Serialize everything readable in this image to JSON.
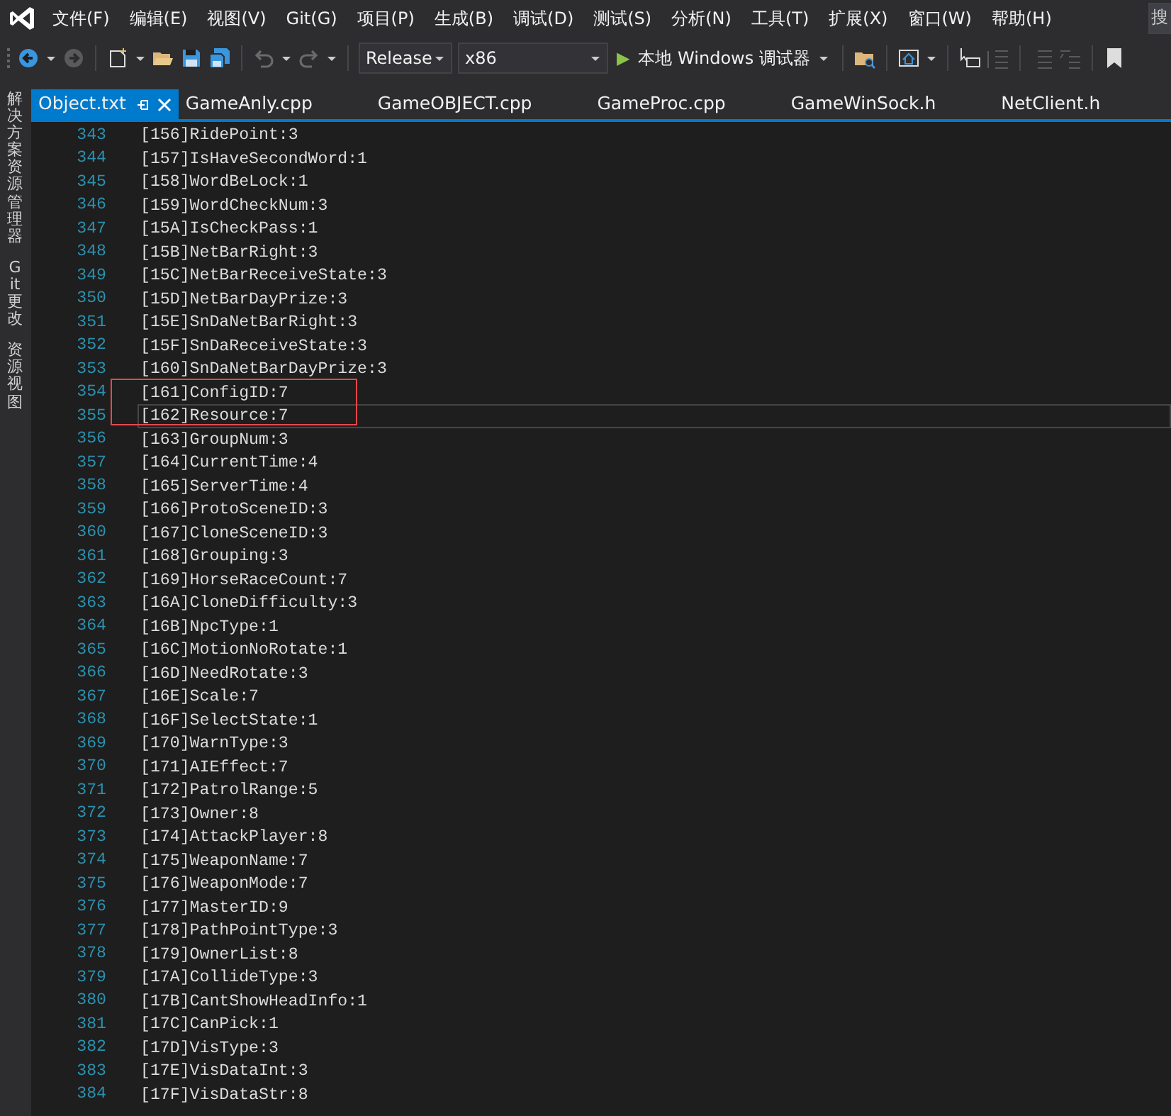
{
  "menu_bar": {
    "items": [
      "文件(F)",
      "编辑(E)",
      "视图(V)",
      "Git(G)",
      "项目(P)",
      "生成(B)",
      "调试(D)",
      "测试(S)",
      "分析(N)",
      "工具(T)",
      "扩展(X)",
      "窗口(W)",
      "帮助(H)"
    ],
    "search": {
      "value": "搜"
    }
  },
  "toolbar": {
    "configuration": "Release",
    "platform": "x86",
    "run": {
      "icon": "▶",
      "label": "本地 Windows 调试器"
    }
  },
  "side_tabs": [
    "解决方案资源管理器",
    "Git 更改",
    "资源视图"
  ],
  "tabs": [
    {
      "label": "Object.txt",
      "selected": true
    },
    {
      "label": "GameAnly.cpp",
      "selected": false
    },
    {
      "label": "GameOBJECT.cpp",
      "selected": false
    },
    {
      "label": "GameProc.cpp",
      "selected": false
    },
    {
      "label": "GameWinSock.h",
      "selected": false
    },
    {
      "label": "NetClient.h",
      "selected": false
    }
  ],
  "editor": {
    "lines": [
      {
        "number": "343",
        "text": "[156]RidePoint:3",
        "current": false
      },
      {
        "number": "344",
        "text": "[157]IsHaveSecondWord:1",
        "current": false
      },
      {
        "number": "345",
        "text": "[158]WordBeLock:1",
        "current": false
      },
      {
        "number": "346",
        "text": "[159]WordCheckNum:3",
        "current": false
      },
      {
        "number": "347",
        "text": "[15A]IsCheckPass:1",
        "current": false
      },
      {
        "number": "348",
        "text": "[15B]NetBarRight:3",
        "current": false
      },
      {
        "number": "349",
        "text": "[15C]NetBarReceiveState:3",
        "current": false
      },
      {
        "number": "350",
        "text": "[15D]NetBarDayPrize:3",
        "current": false
      },
      {
        "number": "351",
        "text": "[15E]SnDaNetBarRight:3",
        "current": false
      },
      {
        "number": "352",
        "text": "[15F]SnDaReceiveState:3",
        "current": false
      },
      {
        "number": "353",
        "text": "[160]SnDaNetBarDayPrize:3",
        "current": false
      },
      {
        "number": "354",
        "text": "[161]ConfigID:7",
        "current": false
      },
      {
        "number": "355",
        "text": "[162]Resource:7",
        "current": true
      },
      {
        "number": "356",
        "text": "[163]GroupNum:3",
        "current": false
      },
      {
        "number": "357",
        "text": "[164]CurrentTime:4",
        "current": false
      },
      {
        "number": "358",
        "text": "[165]ServerTime:4",
        "current": false
      },
      {
        "number": "359",
        "text": "[166]ProtoSceneID:3",
        "current": false
      },
      {
        "number": "360",
        "text": "[167]CloneSceneID:3",
        "current": false
      },
      {
        "number": "361",
        "text": "[168]Grouping:3",
        "current": false
      },
      {
        "number": "362",
        "text": "[169]HorseRaceCount:7",
        "current": false
      },
      {
        "number": "363",
        "text": "[16A]CloneDifficulty:3",
        "current": false
      },
      {
        "number": "364",
        "text": "[16B]NpcType:1",
        "current": false
      },
      {
        "number": "365",
        "text": "[16C]MotionNoRotate:1",
        "current": false
      },
      {
        "number": "366",
        "text": "[16D]NeedRotate:3",
        "current": false
      },
      {
        "number": "367",
        "text": "[16E]Scale:7",
        "current": false
      },
      {
        "number": "368",
        "text": "[16F]SelectState:1",
        "current": false
      },
      {
        "number": "369",
        "text": "[170]WarnType:3",
        "current": false
      },
      {
        "number": "370",
        "text": "[171]AIEffect:7",
        "current": false
      },
      {
        "number": "371",
        "text": "[172]PatrolRange:5",
        "current": false
      },
      {
        "number": "372",
        "text": "[173]Owner:8",
        "current": false
      },
      {
        "number": "373",
        "text": "[174]AttackPlayer:8",
        "current": false
      },
      {
        "number": "374",
        "text": "[175]WeaponName:7",
        "current": false
      },
      {
        "number": "375",
        "text": "[176]WeaponMode:7",
        "current": false
      },
      {
        "number": "376",
        "text": "[177]MasterID:9",
        "current": false
      },
      {
        "number": "377",
        "text": "[178]PathPointType:3",
        "current": false
      },
      {
        "number": "378",
        "text": "[179]OwnerList:8",
        "current": false
      },
      {
        "number": "379",
        "text": "[17A]CollideType:3",
        "current": false
      },
      {
        "number": "380",
        "text": "[17B]CantShowHeadInfo:1",
        "current": false
      },
      {
        "number": "381",
        "text": "[17C]CanPick:1",
        "current": false
      },
      {
        "number": "382",
        "text": "[17D]VisType:3",
        "current": false
      },
      {
        "number": "383",
        "text": "[17E]VisDataInt:3",
        "current": false
      },
      {
        "number": "384",
        "text": "[17F]VisDataStr:8",
        "current": false
      }
    ]
  }
}
